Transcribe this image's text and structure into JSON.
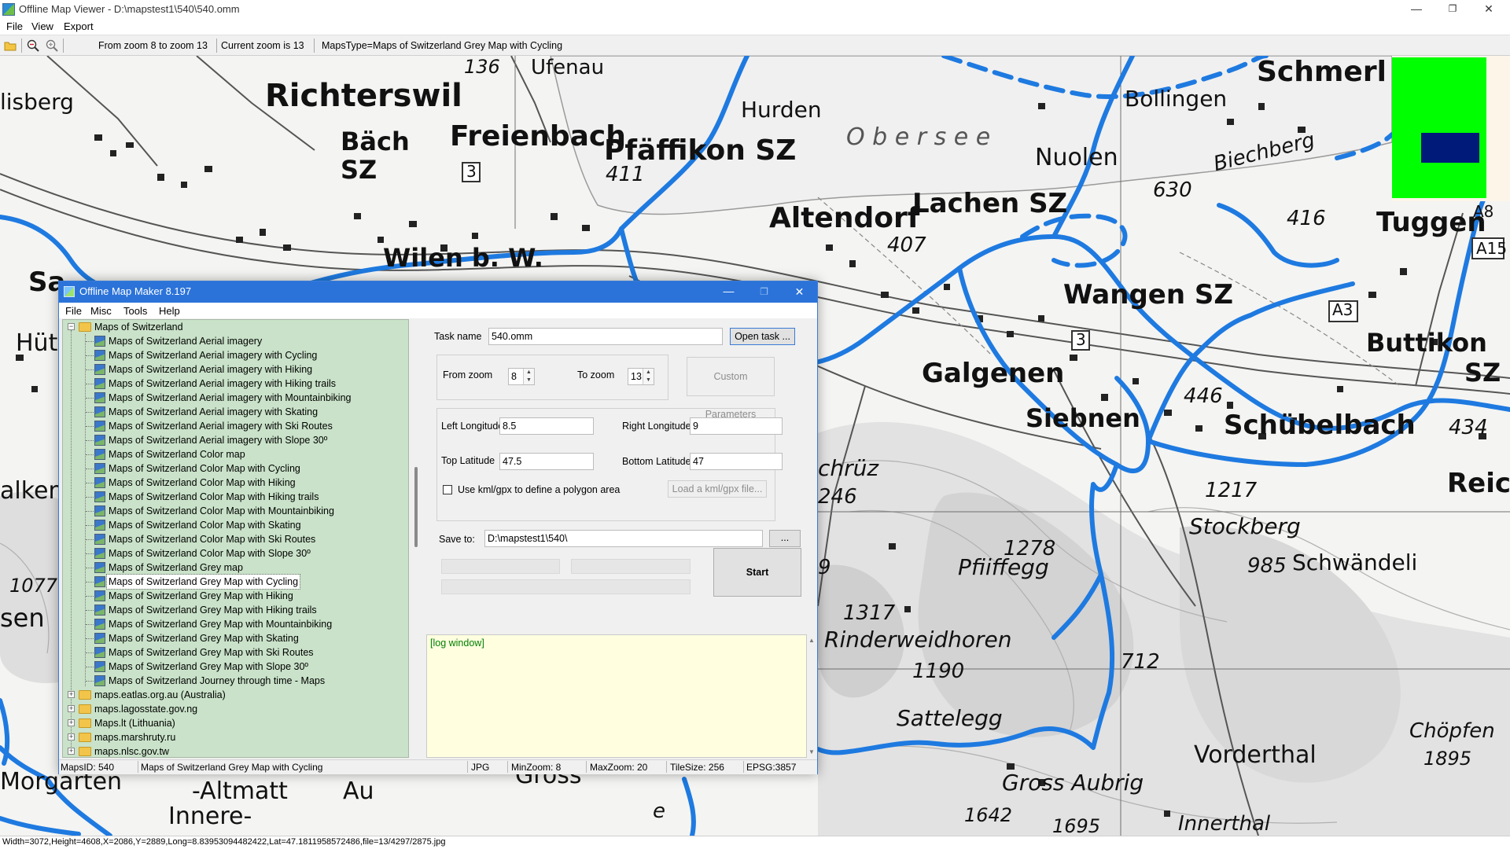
{
  "viewer": {
    "title": "Offline Map Viewer - D:\\mapstest1\\540\\540.omm",
    "menu": [
      "File",
      "View",
      "Export"
    ],
    "window_buttons": {
      "minimize": "—",
      "restore": "❐",
      "close": "✕"
    },
    "toolbar": {
      "zoom_range": "From zoom 8 to zoom 13",
      "current_zoom": "Current zoom is 13",
      "maps_type": "MapsType=Maps of Switzerland Grey Map with Cycling"
    },
    "status": "Width=3072,Height=4608,X=2086,Y=2889,Long=8.83953094482422,Lat=47.1811958572486,file=13/4297/2875.jpg"
  },
  "map": {
    "labels": [
      {
        "text": "lisberg",
        "size": 28
      },
      {
        "text": "Richterswil",
        "size": 40
      },
      {
        "text": "Bäch",
        "size": 32
      },
      {
        "text": "SZ",
        "size": 32
      },
      {
        "text": "Freienbach",
        "size": 36
      },
      {
        "text": "Pfäffikon SZ",
        "size": 36
      },
      {
        "text": "Ufenau",
        "size": 26
      },
      {
        "text": "Hurden",
        "size": 28
      },
      {
        "text": "Bollingen",
        "size": 28
      },
      {
        "text": "Schmerl",
        "size": 36
      },
      {
        "text": "O b e r s e e",
        "size": 30
      },
      {
        "text": "Nuolen",
        "size": 30
      },
      {
        "text": "Altendorf",
        "size": 36
      },
      {
        "text": "Lachen SZ",
        "size": 34
      },
      {
        "text": "Tuggen",
        "size": 34
      },
      {
        "text": "Wilen b. W.",
        "size": 32
      },
      {
        "text": "Wangen SZ",
        "size": 34
      },
      {
        "text": "Galgenen",
        "size": 34
      },
      {
        "text": "Buttikon",
        "size": 32
      },
      {
        "text": "SZ",
        "size": 32
      },
      {
        "text": "Siebnen",
        "size": 32
      },
      {
        "text": "Schübelbach",
        "size": 34
      },
      {
        "text": "Reich",
        "size": 34
      },
      {
        "text": "chrüz",
        "size": 28
      },
      {
        "text": "Stockberg",
        "size": 28
      },
      {
        "text": "Schwändeli",
        "size": 28
      },
      {
        "text": "Pfiiffegg",
        "size": 28
      },
      {
        "text": "Rinderweidhoren",
        "size": 28
      },
      {
        "text": "Sattelegg",
        "size": 28
      },
      {
        "text": "Vorderthal",
        "size": 30
      },
      {
        "text": "Chöpfen",
        "size": 26
      },
      {
        "text": "Gross Aubrig",
        "size": 28
      },
      {
        "text": "Innerthal",
        "size": 26
      },
      {
        "text": "-Altmatt",
        "size": 30
      },
      {
        "text": "Innere-",
        "size": 30
      },
      {
        "text": "Au",
        "size": 30
      },
      {
        "text": "Gross",
        "size": 30
      },
      {
        "text": "Morgarten",
        "size": 30
      },
      {
        "text": "alkenb",
        "size": 30
      },
      {
        "text": "sen",
        "size": 32
      },
      {
        "text": "Hütt",
        "size": 30
      },
      {
        "text": "Sa",
        "size": 34
      },
      {
        "text": "136",
        "size": 24
      },
      {
        "text": "411",
        "size": 26
      },
      {
        "text": "407",
        "size": 26
      },
      {
        "text": "630",
        "size": 26
      },
      {
        "text": "416",
        "size": 26
      },
      {
        "text": "446",
        "size": 26
      },
      {
        "text": "434",
        "size": 26
      },
      {
        "text": "246",
        "size": 26
      },
      {
        "text": "1217",
        "size": 26
      },
      {
        "text": "1278",
        "size": 26
      },
      {
        "text": "985",
        "size": 26
      },
      {
        "text": "1317",
        "size": 26
      },
      {
        "text": "1190",
        "size": 26
      },
      {
        "text": "712",
        "size": 26
      },
      {
        "text": "1895",
        "size": 24
      },
      {
        "text": "1642",
        "size": 24
      },
      {
        "text": "1695",
        "size": 24
      },
      {
        "text": "1077",
        "size": 24
      },
      {
        "text": "A8",
        "size": 20
      },
      {
        "text": "A15",
        "size": 20
      },
      {
        "text": "A3",
        "size": 20
      },
      {
        "text": "3",
        "size": 20
      },
      {
        "text": "3",
        "size": 20
      },
      {
        "text": "Biechberg",
        "size": 26
      },
      {
        "text": "9",
        "size": 26
      },
      {
        "text": "e",
        "size": 26
      }
    ]
  },
  "dialog": {
    "title": "Offline Map Maker 8.197",
    "menu": [
      "File",
      "Misc",
      "Tools",
      "Help"
    ],
    "tree": {
      "root": "Maps of Switzerland",
      "children": [
        "Maps of Switzerland Aerial imagery",
        "Maps of Switzerland Aerial imagery with Cycling",
        "Maps of Switzerland Aerial imagery with Hiking",
        "Maps of Switzerland Aerial imagery with Hiking trails",
        "Maps of Switzerland Aerial imagery with Mountainbiking",
        "Maps of Switzerland Aerial imagery with Skating",
        "Maps of Switzerland Aerial imagery with Ski Routes",
        "Maps of Switzerland Aerial imagery with Slope 30º",
        "Maps of Switzerland Color map",
        "Maps of Switzerland Color Map with Cycling",
        "Maps of Switzerland Color Map with Hiking",
        "Maps of Switzerland Color Map with Hiking trails",
        "Maps of Switzerland Color Map with Mountainbiking",
        "Maps of Switzerland Color Map with Skating",
        "Maps of Switzerland Color Map with Ski Routes",
        "Maps of Switzerland Color Map with Slope 30º",
        "Maps of Switzerland Grey map",
        "Maps of Switzerland Grey Map with Cycling",
        "Maps of Switzerland Grey Map with Hiking",
        "Maps of Switzerland Grey Map with Hiking trails",
        "Maps of Switzerland Grey Map with Mountainbiking",
        "Maps of Switzerland Grey Map with Skating",
        "Maps of Switzerland Grey Map with Ski Routes",
        "Maps of Switzerland Grey Map with Slope 30º",
        "Maps of Switzerland Journey through time - Maps"
      ],
      "selected": "Maps of Switzerland Grey Map with Cycling",
      "other_roots": [
        "maps.eatlas.org.au (Australia)",
        "maps.lagosstate.gov.ng",
        "Maps.lt (Lithuania)",
        "maps.marshruty.ru",
        "maps.nlsc.gov.tw"
      ]
    },
    "form": {
      "task_name_label": "Task name",
      "task_name": "540.omm",
      "open_task_button": "Open task ...",
      "from_zoom_label": "From zoom",
      "from_zoom": "8",
      "to_zoom_label": "To zoom",
      "to_zoom": "13",
      "custom_params_button": "Custom Parameters",
      "left_lon_label": "Left Longitude",
      "left_lon": "8.5",
      "right_lon_label": "Right Longitude",
      "right_lon": "9",
      "top_lat_label": "Top Latitude",
      "top_lat": "47.5",
      "bottom_lat_label": "Bottom Latitude",
      "bottom_lat": "47",
      "kml_checkbox_label": "Use kml/gpx to define a polygon area",
      "load_kml_button": "Load a kml/gpx file...",
      "save_to_label": "Save to:",
      "save_to": "D:\\mapstest1\\540\\",
      "browse_button": "...",
      "start_button": "Start"
    },
    "log_text": "[log window]",
    "status": {
      "maps_id": "MapsID: 540",
      "map_name": "Maps of Switzerland Grey Map with Cycling",
      "format": "JPG",
      "min_zoom": "MinZoom: 8",
      "max_zoom": "MaxZoom: 20",
      "tile_size": "TileSize: 256",
      "epsg": "EPSG:3857"
    }
  },
  "colors": {
    "route": "#1e7ae0",
    "dialog_title": "#2b73d9",
    "tree_bg": "#c9e2c9",
    "log_bg": "#ffffe0",
    "minimap_green": "#00ff00",
    "minimap_viewport": "#001a7a"
  }
}
